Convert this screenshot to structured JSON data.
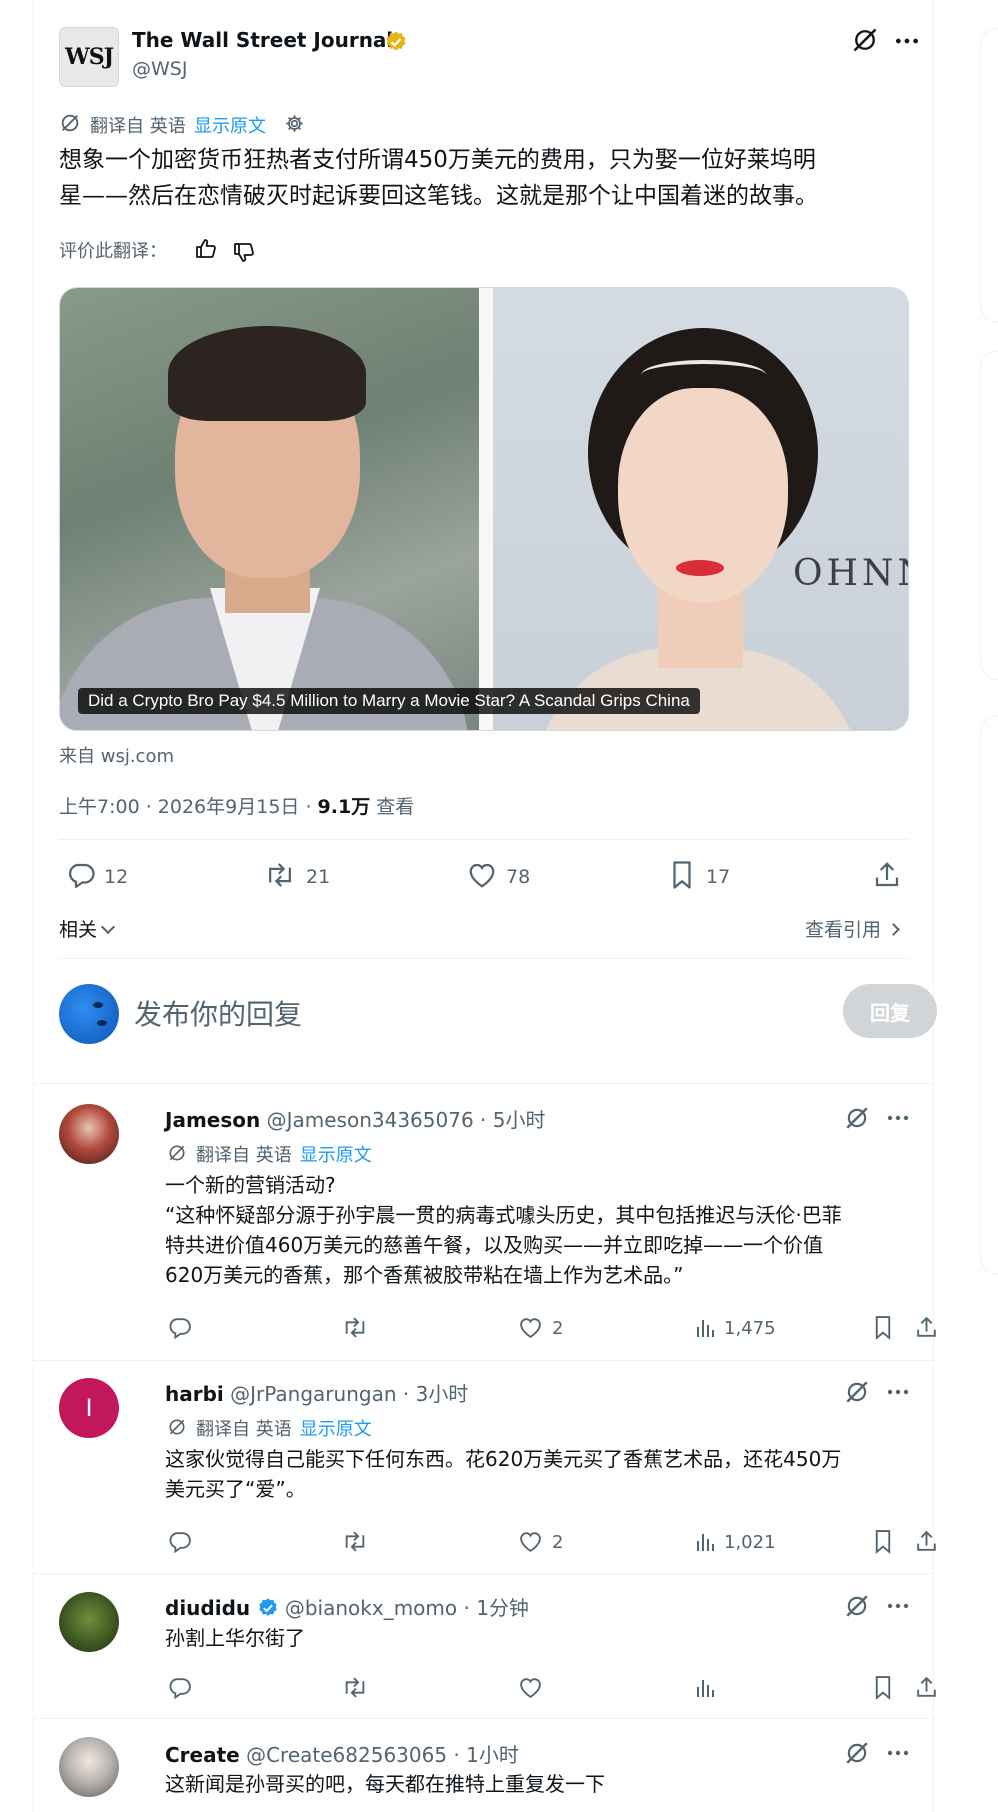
{
  "tweet": {
    "author_name": "The Wall Street Journal",
    "handle": "@WSJ",
    "logo_text": "WSJ",
    "translated_from": "翻译自 英语",
    "show_original": "显示原文",
    "text_line1": "想象一个加密货币狂热者支付所谓450万美元的费用，只为娶一位好莱坞明",
    "text_line2": "星——然后在恋情破灭时起诉要回这笔钱。这就是那个让中国着迷的故事。",
    "rate_translation": "评价此翻译：",
    "card_headline": "Did a Crypto Bro Pay $4.5 Million to Marry a Movie Star? A Scandal Grips China",
    "card_backdrop_text": "OHNN",
    "source": "来自 wsj.com",
    "time": "上午7:00 · 2026年9月15日 · ",
    "views": "9.1万",
    "views_label": " 查看",
    "replies": "12",
    "retweets": "21",
    "likes": "78",
    "bookmarks": "17",
    "related": "相关",
    "view_quotes": "查看引用"
  },
  "composer": {
    "placeholder": "发布你的回复",
    "button": "回复"
  },
  "replies": [
    {
      "name": "Jameson",
      "handle": "@Jameson34365076",
      "time": " · 5小时",
      "translated_from": "翻译自 英语",
      "show_original": "显示原文",
      "lines": [
        "一个新的营销活动?",
        "“这种怀疑部分源于孙宇晨一贯的病毒式噱头历史，其中包括推迟与沃伦·巴菲",
        "特共进价值460万美元的慈善午餐，以及购买——并立即吃掉——一个价值",
        "620万美元的香蕉，那个香蕉被胶带粘在墙上作为艺术品。”"
      ],
      "likes": "2",
      "views": "1,475"
    },
    {
      "name": "harbi",
      "handle": "@JrPangarungan",
      "time": " · 3小时",
      "avatar_letter": "I",
      "translated_from": "翻译自 英语",
      "show_original": "显示原文",
      "lines": [
        "这家伙觉得自己能买下任何东西。花620万美元买了香蕉艺术品，还花450万",
        "美元买了“爱”。"
      ],
      "likes": "2",
      "views": "1,021"
    },
    {
      "name": "diudidu",
      "handle": "@bianokx_momo",
      "time": " · 1分钟",
      "lines": [
        "孙割上华尔街了"
      ]
    },
    {
      "name": "Create",
      "handle": "@Create682563065",
      "time": " · 1小时",
      "lines": [
        "这新闻是孙哥买的吧，每天都在推特上重复发一下"
      ]
    }
  ],
  "colors": {
    "accent": "#1d9bf0",
    "verified_gold": "#e2b719",
    "text": "#0f1419",
    "muted": "#536471",
    "harbi_avatar": "#c2185b"
  }
}
